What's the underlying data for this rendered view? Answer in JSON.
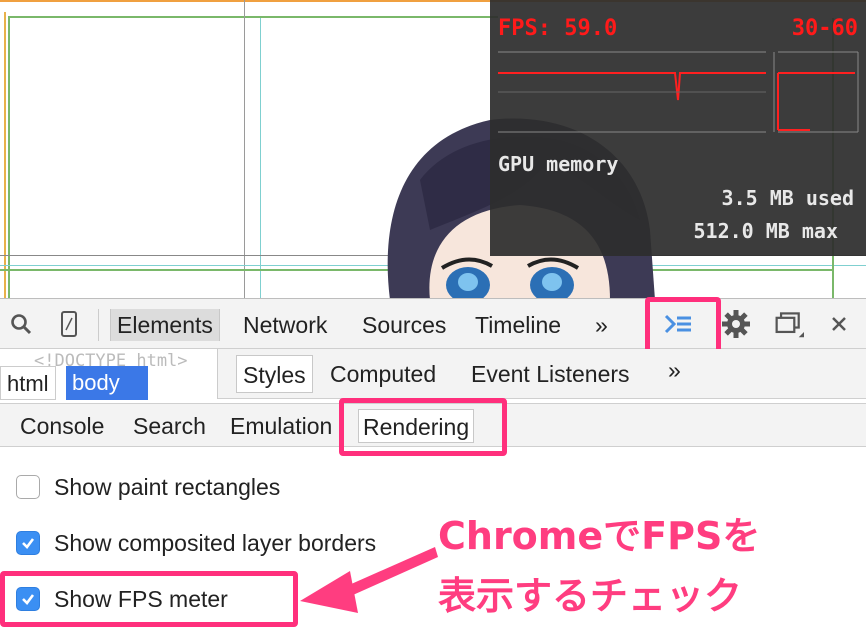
{
  "fps_meter": {
    "title": "FPS: 59.0",
    "range": "30-60",
    "gpu_label": "GPU memory",
    "used": "3.5 MB used",
    "max": "512.0 MB max"
  },
  "toolbar": {
    "tabs": [
      "Elements",
      "Network",
      "Sources",
      "Timeline"
    ],
    "more": "»"
  },
  "breadcrumb": {
    "doctype": "<!DOCTYPE html>",
    "items": [
      "html",
      "body"
    ]
  },
  "styles_pane": {
    "tabs": [
      "Styles",
      "Computed",
      "Event Listeners"
    ],
    "more": "»"
  },
  "drawer": {
    "tabs": [
      "Console",
      "Search",
      "Emulation",
      "Rendering"
    ]
  },
  "rendering": {
    "options": [
      {
        "label": "Show paint rectangles",
        "checked": false
      },
      {
        "label": "Show composited layer borders",
        "checked": true
      },
      {
        "label": "Show FPS meter",
        "checked": true
      }
    ]
  },
  "annotation": {
    "line1": "ChromeでFPSを",
    "line2": "表示するチェック"
  },
  "colors": {
    "highlight": "#ff2f7c",
    "fps_red": "#ff1a1a",
    "checkbox_blue": "#3b8ff3",
    "selected_crumb": "#3b78e7"
  }
}
